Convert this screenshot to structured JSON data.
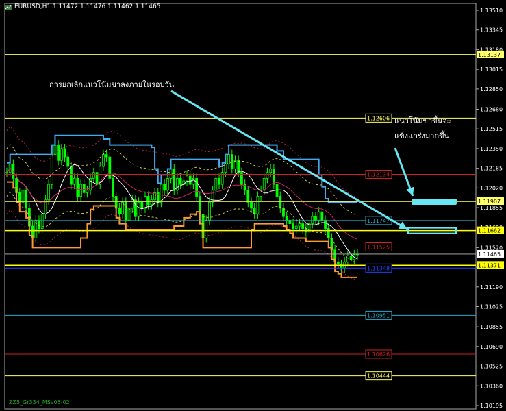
{
  "header": {
    "symbol_label": "EURUSD,H1  1.11472 1.11476 1.11462 1.11465"
  },
  "footer": {
    "indicator_label": "ZZ5_Gr334_MSv05-02"
  },
  "annotations": {
    "top_left": "การยกเลิกแนวโน้มขาลงภายในรอบวัน",
    "right_line1": "แนวโน้มขาขึ้นจะ",
    "right_line2": "แข็งแกร่งมากขึ้น"
  },
  "chart_data": {
    "type": "candlestick",
    "symbol": "EURUSD",
    "timeframe": "H1",
    "ohlc_last": {
      "open": 1.11472,
      "high": 1.11476,
      "low": 1.11462,
      "close": 1.11465
    },
    "ylim": [
      1.10195,
      1.1351
    ],
    "y_ticks": [
      1.1351,
      1.13345,
      1.1318,
      1.13015,
      1.1285,
      1.1268,
      1.12515,
      1.1235,
      1.12185,
      1.1202,
      1.11855,
      1.1169,
      1.1152,
      1.11355,
      1.1119,
      1.11025,
      1.10855,
      1.1069,
      1.10525,
      1.1036,
      1.10195
    ],
    "current_price": "1.11465",
    "levels": [
      {
        "price": 1.13137,
        "label": "1.13137",
        "color": "#ffff66",
        "label_on_axis": true
      },
      {
        "price": 1.12606,
        "label": "1.12606",
        "color": "#ffff66",
        "label_on_axis": false
      },
      {
        "price": 1.12134,
        "label": "1.12134",
        "color": "#cc2222",
        "label_on_axis": false
      },
      {
        "price": 1.11907,
        "label": "1.11907",
        "color": "#ffff66",
        "label_on_axis": true
      },
      {
        "price": 1.11747,
        "label": "1.11747",
        "color": "#22aacc",
        "label_on_axis": false
      },
      {
        "price": 1.11662,
        "label": "1.11662",
        "color": "#ffff00",
        "label_on_axis": true
      },
      {
        "price": 1.11525,
        "label": "1.11525",
        "color": "#cc2222",
        "label_on_axis": false
      },
      {
        "price": 1.11371,
        "label": "1.11371",
        "color": "#ffff00",
        "label_on_axis": true
      },
      {
        "price": 1.11348,
        "label": "1.11348",
        "color": "#2244ff",
        "label_on_axis": false
      },
      {
        "price": 1.10951,
        "label": "1.10951",
        "color": "#22aacc",
        "label_on_axis": false
      },
      {
        "price": 1.10626,
        "label": "1.10626",
        "color": "#cc2222",
        "label_on_axis": false
      },
      {
        "price": 1.10444,
        "label": "1.10444",
        "color": "#ffff66",
        "label_on_axis": false
      }
    ],
    "closes": [
      1.1215,
      1.1222,
      1.121,
      1.1198,
      1.119,
      1.12,
      1.1185,
      1.117,
      1.116,
      1.1175,
      1.1168,
      1.118,
      1.1192,
      1.1205,
      1.123,
      1.1238,
      1.1225,
      1.1235,
      1.1228,
      1.122,
      1.1205,
      1.121,
      1.1195,
      1.1205,
      1.1198,
      1.12,
      1.121,
      1.1215,
      1.1205,
      1.122,
      1.123,
      1.1228,
      1.121,
      1.1195,
      1.1185,
      1.118,
      1.119,
      1.1175,
      1.1185,
      1.1192,
      1.1178,
      1.119,
      1.1185,
      1.1195,
      1.1188,
      1.1192,
      1.1198,
      1.119,
      1.1205,
      1.12,
      1.121,
      1.1218,
      1.12,
      1.121,
      1.1205,
      1.1208,
      1.1212,
      1.1205,
      1.121,
      1.1195,
      1.118,
      1.116,
      1.1175,
      1.119,
      1.12,
      1.121,
      1.1205,
      1.1215,
      1.1222,
      1.123,
      1.1218,
      1.1225,
      1.1215,
      1.1205,
      1.12,
      1.119,
      1.1185,
      1.118,
      1.1195,
      1.12,
      1.121,
      1.1215,
      1.1218,
      1.1205,
      1.1195,
      1.1185,
      1.1178,
      1.1175,
      1.1172,
      1.1168,
      1.117,
      1.1172,
      1.1168,
      1.1165,
      1.1172,
      1.1178,
      1.1175,
      1.1182,
      1.1175,
      1.1168,
      1.116,
      1.115,
      1.114,
      1.1138,
      1.1135,
      1.114,
      1.1145,
      1.1142,
      1.1146,
      1.11465
    ],
    "annotation_arrows": [
      {
        "from_price": 1.128,
        "to_price": 1.1166,
        "color": "#66e6f2"
      },
      {
        "from_price": 1.123,
        "to_price": 1.1193,
        "color": "#66e6f2"
      }
    ]
  }
}
